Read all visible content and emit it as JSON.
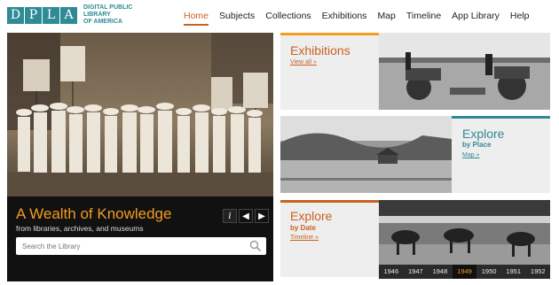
{
  "brand": {
    "letters": [
      "D",
      "P",
      "L",
      "A"
    ],
    "line1": "DIGITAL PUBLIC LIBRARY",
    "line2": "OF AMERICA",
    "color": "#2e8b96"
  },
  "nav": {
    "items": [
      {
        "label": "Home",
        "active": true
      },
      {
        "label": "Subjects"
      },
      {
        "label": "Collections"
      },
      {
        "label": "Exhibitions"
      },
      {
        "label": "Map"
      },
      {
        "label": "Timeline"
      },
      {
        "label": "App Library"
      },
      {
        "label": "Help"
      }
    ],
    "accent": "#c8611f"
  },
  "hero": {
    "title": "A Wealth of Knowledge",
    "subtitle": "from libraries, archives, and museums",
    "controls": {
      "info": "i",
      "prev": "◀",
      "next": "▶"
    },
    "search_placeholder": "Search the Library",
    "title_color": "#f39c1f"
  },
  "panels": {
    "exhibitions": {
      "title": "Exhibitions",
      "link": "View all »"
    },
    "place": {
      "title": "Explore",
      "subtitle": "by Place",
      "link": "Map »"
    },
    "date": {
      "title": "Explore",
      "subtitle": "by Date",
      "link": "Timeline »"
    }
  },
  "timeline": {
    "years": [
      "1946",
      "1947",
      "1948",
      "1949",
      "1950",
      "1951",
      "1952"
    ],
    "selected": "1949"
  }
}
